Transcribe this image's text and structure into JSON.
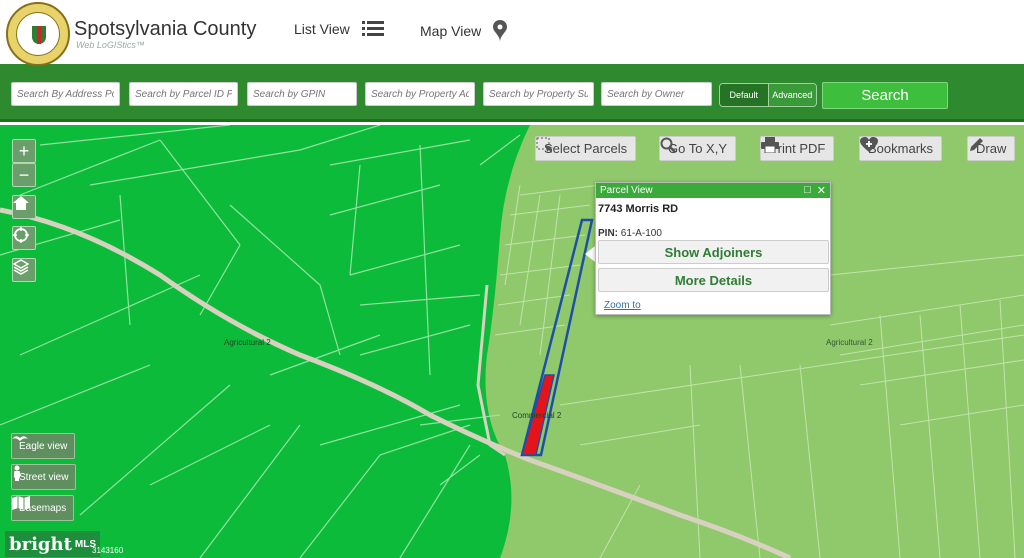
{
  "header": {
    "brand_title": "Spotsylvania County",
    "brand_subtitle": "Web LoGIStics™",
    "seal_text": "COUNTY OF SPOTSYLVANIA, VIRGINIA",
    "nav": [
      {
        "label": "List View",
        "icon": "list-icon"
      },
      {
        "label": "Map View",
        "icon": "map-pin-icon"
      }
    ]
  },
  "searchbar": {
    "inputs": [
      {
        "placeholder": "Search By Address Poin"
      },
      {
        "placeholder": "Search by Parcel ID PIN"
      },
      {
        "placeholder": "Search by GPIN"
      },
      {
        "placeholder": "Search by Property Addi"
      },
      {
        "placeholder": "Search by Property Subi"
      },
      {
        "placeholder": "Search by Owner"
      }
    ],
    "mode_options": [
      "Default",
      "Advanced"
    ],
    "mode_selected": "Default",
    "search_label": "Search"
  },
  "map": {
    "zoom_in": "+",
    "zoom_out": "−",
    "toolbar": [
      {
        "label": "Select Parcels",
        "icon": "select-parcels-icon"
      },
      {
        "label": "Go To X,Y",
        "icon": "zoom-search-icon"
      },
      {
        "label": "Print PDF",
        "icon": "printer-icon"
      },
      {
        "label": "Bookmarks",
        "icon": "bookmark-plus-icon"
      },
      {
        "label": "Draw",
        "icon": "pencil-icon"
      }
    ],
    "side_buttons": [
      {
        "label": "Eagle view",
        "icon": "eagle-icon"
      },
      {
        "label": "Street view",
        "icon": "person-icon"
      },
      {
        "label": "Basemaps",
        "icon": "map-icon"
      }
    ],
    "zone_labels": [
      "Agricultural 2",
      "Agricultural 2",
      "Commercial 2"
    ],
    "colors": {
      "left_zone": "#0dbb3b",
      "right_zone": "#8fc96c",
      "selected_outline": "#1e4fa8",
      "highlight": "#e3151a",
      "road": "#d9d1c0"
    }
  },
  "popup": {
    "title": "Parcel View",
    "address": "7743 Morris RD",
    "pin_label": "PIN:",
    "pin_value": "61-A-100",
    "show_adjoiners": "Show Adjoiners",
    "more_details": "More Details",
    "zoom_to": "Zoom to"
  },
  "watermark": {
    "brand": "bright",
    "mls": "MLS",
    "fragment": "3143160"
  }
}
